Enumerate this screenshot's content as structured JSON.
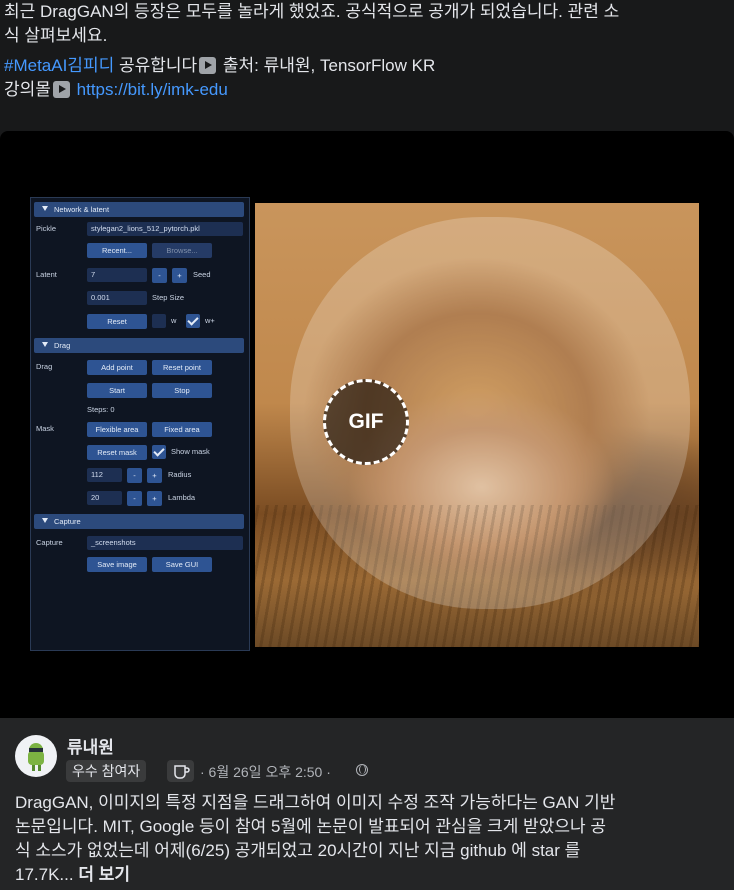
{
  "post": {
    "line1": "최근 DragGAN의 등장은 모두를 놀라게 했었죠. 공식적으로 공개가 되었습니다. 관련 소",
    "line2": "식 살펴보세요.",
    "hashtag": "#MetaAI김피디",
    "share_text": " 공유합니다",
    "source_text": " 출처: 류내원, TensorFlow KR",
    "course_label": "강의몰",
    "course_link": "https://bit.ly/imk-edu"
  },
  "media": {
    "gif_label": "GIF",
    "gui": {
      "network_header": "Network & latent",
      "pickle_label": "Pickle",
      "pickle_value": "stylegan2_lions_512_pytorch.pkl",
      "recent_button": "Recent...",
      "browse_button": "Browse...",
      "latent_label": "Latent",
      "latent_value": "7",
      "minus": "-",
      "plus": "+",
      "seed_label": "Seed",
      "step_value": "0.001",
      "step_label": "Step Size",
      "reset_button": "Reset",
      "w_label": "w",
      "wplus_label": "w+",
      "drag_header": "Drag",
      "drag_label": "Drag",
      "add_point": "Add point",
      "reset_point": "Reset point",
      "start": "Start",
      "stop": "Stop",
      "steps": "Steps: 0",
      "mask_label": "Mask",
      "flexible_area": "Flexible area",
      "fixed_area": "Fixed area",
      "reset_mask": "Reset mask",
      "show_mask": "Show mask",
      "radius_value": "112",
      "radius_label": "Radius",
      "lambda_value": "20",
      "lambda_label": "Lambda",
      "capture_header": "Capture",
      "capture_label": "Capture",
      "capture_value": "_screenshots",
      "save_image": "Save image",
      "save_gui": "Save GUI"
    }
  },
  "comment": {
    "author": "류내원",
    "badge": "우수 참여자",
    "time": "· 6월 26일 오후 2:50 ·",
    "line1": "DragGAN, 이미지의 특정 지점을 드래그하여 이미지 수정 조작 가능하다는 GAN 기반",
    "line2": "논문입니다. MIT, Google 등이 참여 5월에 논문이 발표되어 관심을 크게 받았으나 공",
    "line3": "식 소스가 없었는데 어제(6/25) 공개되었고 20시간이 지난 지금 github 에 star 를",
    "line4": "17.7K...",
    "more": "더 보기"
  },
  "colors": {
    "link": "#4599ff",
    "background": "#18191a",
    "comment_bg": "#242526",
    "gui_accent": "#2e5493"
  }
}
